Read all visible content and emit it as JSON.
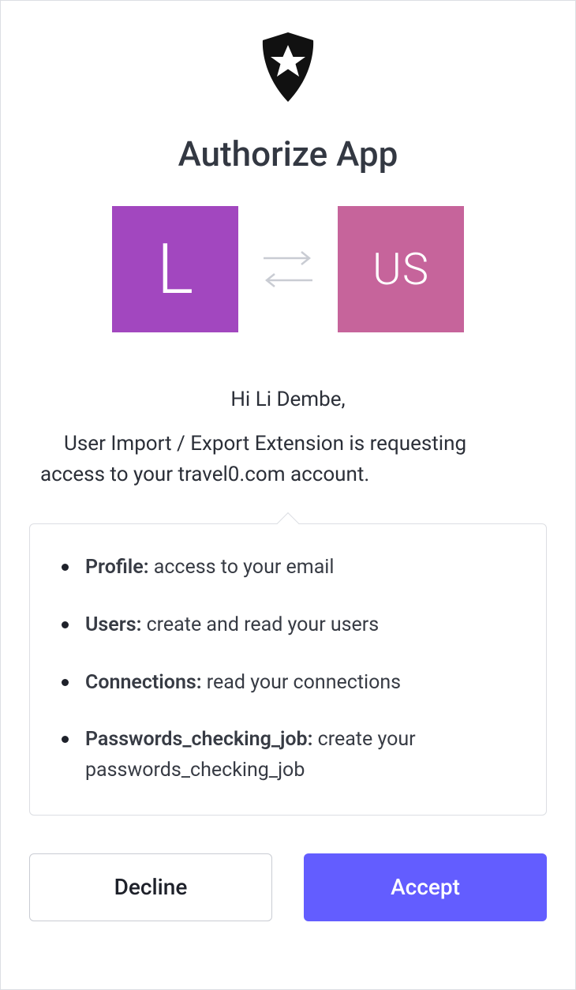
{
  "title": "Authorize App",
  "apps": {
    "leftInitial": "L",
    "leftColor": "#a247bf",
    "rightInitial": "US",
    "rightColor": "#c6649b"
  },
  "greeting": {
    "prefix": "Hi ",
    "name": "Li Dembe",
    "suffix": ","
  },
  "request": {
    "appName": "User Import / Export Extension",
    "mid": " is requesting access to your ",
    "account": "travel0.com",
    "tail": " account."
  },
  "scopes": [
    {
      "title": "Profile:",
      "desc": " access to your email"
    },
    {
      "title": "Users:",
      "desc": " create and read your users"
    },
    {
      "title": "Connections:",
      "desc": " read your connections"
    },
    {
      "title": "Passwords_checking_job:",
      "desc": " create your passwords_checking_job"
    }
  ],
  "buttons": {
    "decline": "Decline",
    "accept": "Accept"
  }
}
